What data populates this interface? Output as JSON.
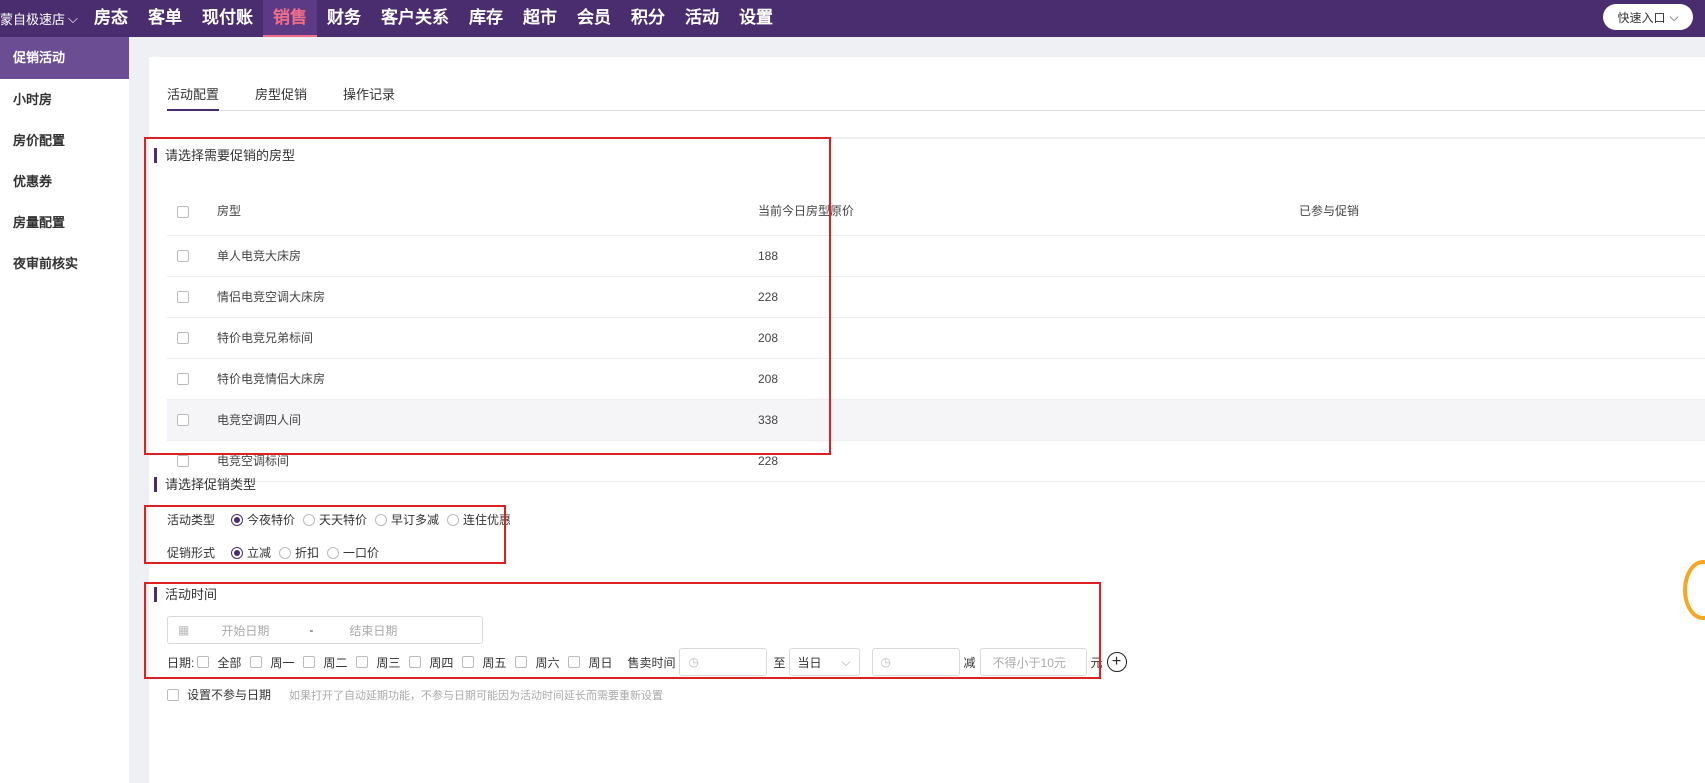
{
  "header": {
    "store_name": "蒙自极速店",
    "nav": [
      "房态",
      "客单",
      "现付账",
      "销售",
      "财务",
      "客户关系",
      "库存",
      "超市",
      "会员",
      "积分",
      "活动",
      "设置"
    ],
    "active_nav": "销售",
    "quick_entry": "快速入口"
  },
  "sidebar": {
    "items": [
      {
        "label": "促销活动",
        "active": true
      },
      {
        "label": "小时房"
      },
      {
        "label": "房价配置"
      },
      {
        "label": "优惠券"
      },
      {
        "label": "房量配置"
      },
      {
        "label": "夜审前核实"
      }
    ]
  },
  "tabs": [
    {
      "label": "活动配置",
      "active": true
    },
    {
      "label": "房型促销"
    },
    {
      "label": "操作记录"
    }
  ],
  "room_section": {
    "title": "请选择需要促销的房型",
    "columns": [
      "房型",
      "当前今日房型原价",
      "已参与促销"
    ],
    "rows": [
      {
        "name": "单人电竞大床房",
        "price": "188"
      },
      {
        "name": "情侣电竞空调大床房",
        "price": "228"
      },
      {
        "name": "特价电竞兄弟标间",
        "price": "208"
      },
      {
        "name": "特价电竞情侣大床房",
        "price": "208"
      },
      {
        "name": "电竞空调四人间",
        "price": "338"
      },
      {
        "name": "电竞空调标间",
        "price": "228"
      }
    ]
  },
  "promo_type": {
    "title": "请选择促销类型",
    "activity_label": "活动类型",
    "activity_options": [
      {
        "label": "今夜特价",
        "selected": true
      },
      {
        "label": "天天特价"
      },
      {
        "label": "早订多减"
      },
      {
        "label": "连住优惠"
      }
    ],
    "form_label": "促销形式",
    "form_options": [
      {
        "label": "立减",
        "selected": true
      },
      {
        "label": "折扣"
      },
      {
        "label": "一口价"
      }
    ]
  },
  "time_section": {
    "title": "活动时间",
    "start_placeholder": "开始日期",
    "separator": "-",
    "end_placeholder": "结束日期",
    "date_label": "日期:",
    "days": [
      "全部",
      "周一",
      "周二",
      "周三",
      "周四",
      "周五",
      "周六",
      "周日"
    ],
    "sale_time_label": "售卖时间",
    "to_label": "至",
    "same_day": "当日",
    "reduce_label": "减",
    "amount_placeholder": "不得小于10元",
    "currency": "元"
  },
  "no_date": {
    "label": "设置不参与日期",
    "hint": "如果打开了自动延期功能，不参与日期可能因为活动时间延长而需要重新设置"
  }
}
